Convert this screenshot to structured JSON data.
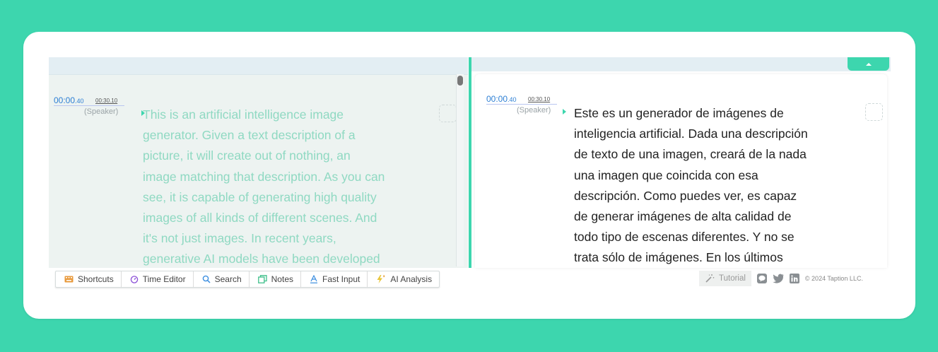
{
  "left_segment": {
    "time_main": "00:00",
    "time_main_ms": ".40",
    "time_end": "00:30.10",
    "speaker": "(Speaker)",
    "lines": [
      "This is an artificial intelligence image",
      "generator. Given a text description of a",
      "picture, it will create out of nothing, an",
      "image matching that description. As you can",
      "see, it is capable of generating high quality",
      "images of all kinds of different scenes. And",
      "it's not just images. In recent years,",
      "generative AI models have been developed"
    ]
  },
  "right_segment": {
    "time_main": "00:00",
    "time_main_ms": ".40",
    "time_end": "00:30.10",
    "speaker": "(Speaker)",
    "lines": [
      "Este es un generador de imágenes de",
      "inteligencia artificial. Dada una descripción",
      "de texto de una imagen, creará de la nada",
      "una imagen que coincida con esa",
      "descripción. Como puedes ver, es capaz",
      "de generar imágenes de alta calidad de",
      "todo tipo de escenas diferentes. Y no se",
      "trata sólo de imágenes. En los últimos"
    ]
  },
  "toolbar": {
    "shortcuts": "Shortcuts",
    "time_editor": "Time Editor",
    "search": "Search",
    "notes": "Notes",
    "fast_input": "Fast Input",
    "ai_analysis": "AI Analysis"
  },
  "footer": {
    "tutorial": "Tutorial",
    "copyright": "© 2024 Taption LLC."
  },
  "colors": {
    "accent": "#3dd6ae",
    "link_blue": "#2d7fd4",
    "faded_text": "#8fd9c2"
  }
}
